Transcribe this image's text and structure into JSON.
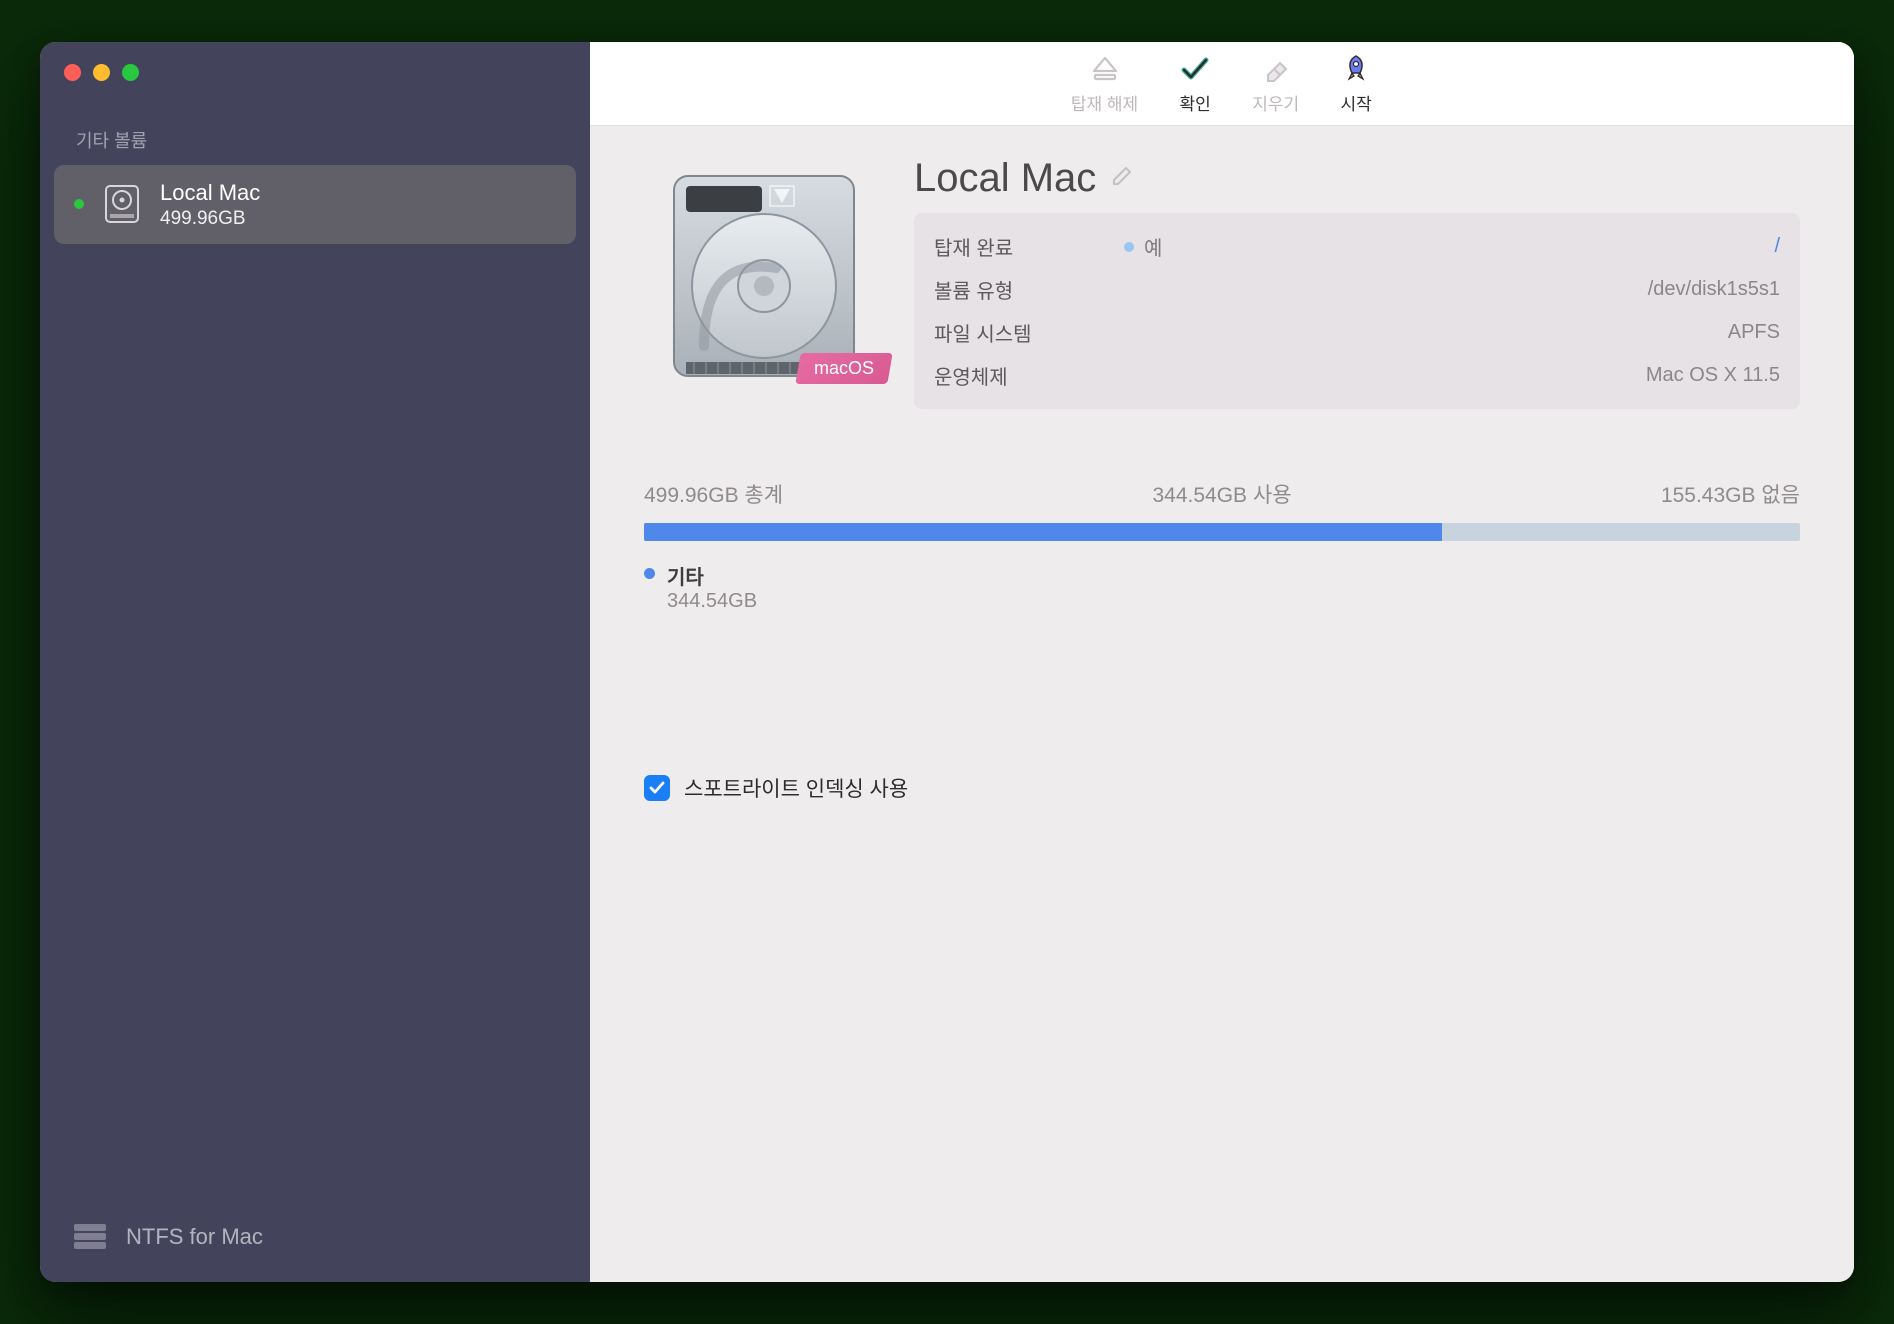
{
  "sidebar": {
    "section_label": "기타 볼륨",
    "items": [
      {
        "name": "Local Mac",
        "size": "499.96GB"
      }
    ],
    "bottom_label": "NTFS for Mac"
  },
  "toolbar": {
    "eject": "탑재 해제",
    "verify": "확인",
    "erase": "지우기",
    "start": "시작"
  },
  "volume": {
    "title": "Local Mac",
    "os_badge": "macOS",
    "properties": {
      "mounted_label": "탑재 완료",
      "mounted_value": "예",
      "mount_point": "/",
      "type_label": "볼륨 유형",
      "type_value": "/dev/disk1s5s1",
      "fs_label": "파일 시스템",
      "fs_value": "APFS",
      "os_label": "운영체제",
      "os_value": "Mac OS X 11.5"
    }
  },
  "storage": {
    "total_label": "499.96GB 총계",
    "used_label": "344.54GB 사용",
    "free_label": "155.43GB 없음",
    "used_percent": 69,
    "legend": {
      "name": "기타",
      "size": "344.54GB"
    }
  },
  "spotlight": {
    "label": "스포트라이트 인덱싱 사용",
    "checked": true
  }
}
